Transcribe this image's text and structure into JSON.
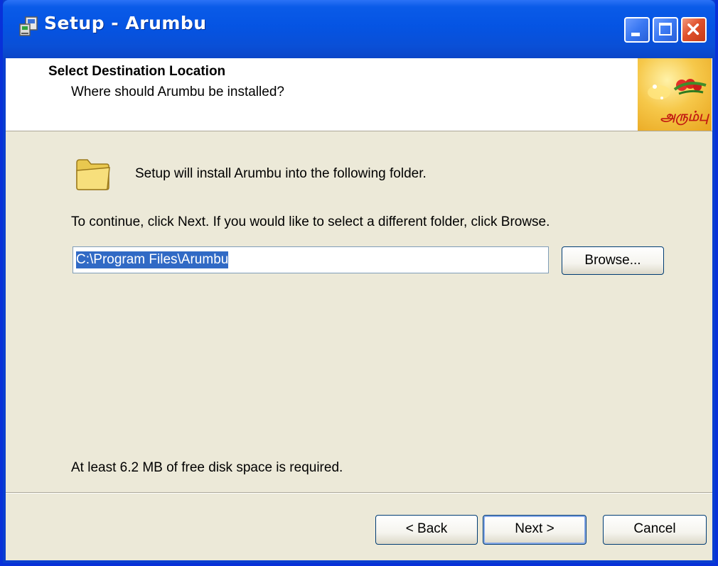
{
  "window": {
    "title": "Setup - Arumbu"
  },
  "header": {
    "title": "Select Destination Location",
    "subtitle": "Where should Arumbu be installed?",
    "logo_text": "அரும்பு"
  },
  "body": {
    "intro": "Setup will install Arumbu into the following folder.",
    "instruction": "To continue, click Next. If you would like to select a different folder, click Browse.",
    "path_value": "C:\\Program Files\\Arumbu",
    "browse_label": "Browse...",
    "disk_space": "At least 6.2 MB of free disk space is required."
  },
  "footer": {
    "back_label": "< Back",
    "next_label": "Next >",
    "cancel_label": "Cancel"
  },
  "icons": {
    "app": "setup-app-icon",
    "folder": "folder-icon",
    "minimize": "minimize-icon",
    "maximize": "maximize-icon",
    "close": "close-icon"
  },
  "colors": {
    "titlebar": "#0554e3",
    "client_bg": "#ece9d8",
    "selection": "#316ac5",
    "close_button": "#e0512c"
  }
}
